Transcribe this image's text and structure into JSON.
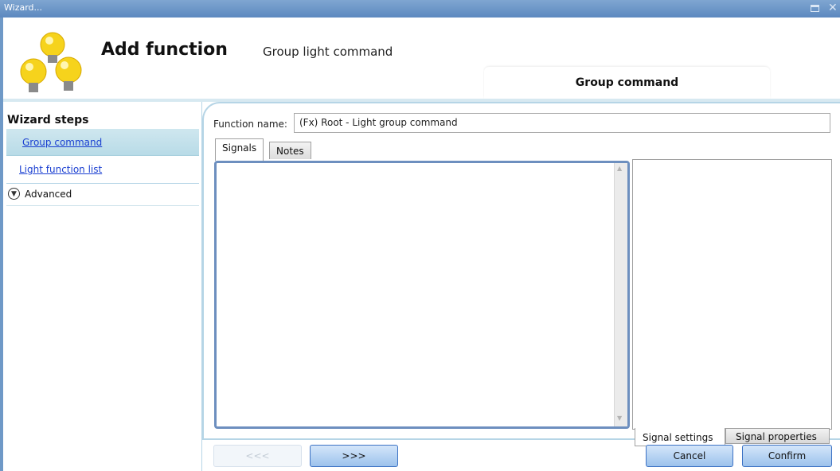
{
  "window": {
    "title": "Wizard...",
    "accent_color": "#6f99c7"
  },
  "header": {
    "title": "Add function",
    "subtitle": "Group light command",
    "tab_label": "Group command",
    "logo_icon": "light-bulbs-icon"
  },
  "sidebar": {
    "heading": "Wizard steps",
    "items": [
      {
        "label": "Group command",
        "selected": true
      },
      {
        "label": "Light function list",
        "selected": false
      }
    ],
    "advanced_label": "Advanced"
  },
  "form": {
    "function_name_label": "Function name:",
    "function_name_value": "(Fx) Root - Light group command"
  },
  "tabs": {
    "signals": "Signals",
    "notes": "Notes",
    "signal_settings": "Signal settings",
    "signal_properties": "Signal properties"
  },
  "buttons": {
    "prev": "<<<",
    "next": ">>>",
    "cancel": "Cancel",
    "confirm": "Confirm"
  }
}
